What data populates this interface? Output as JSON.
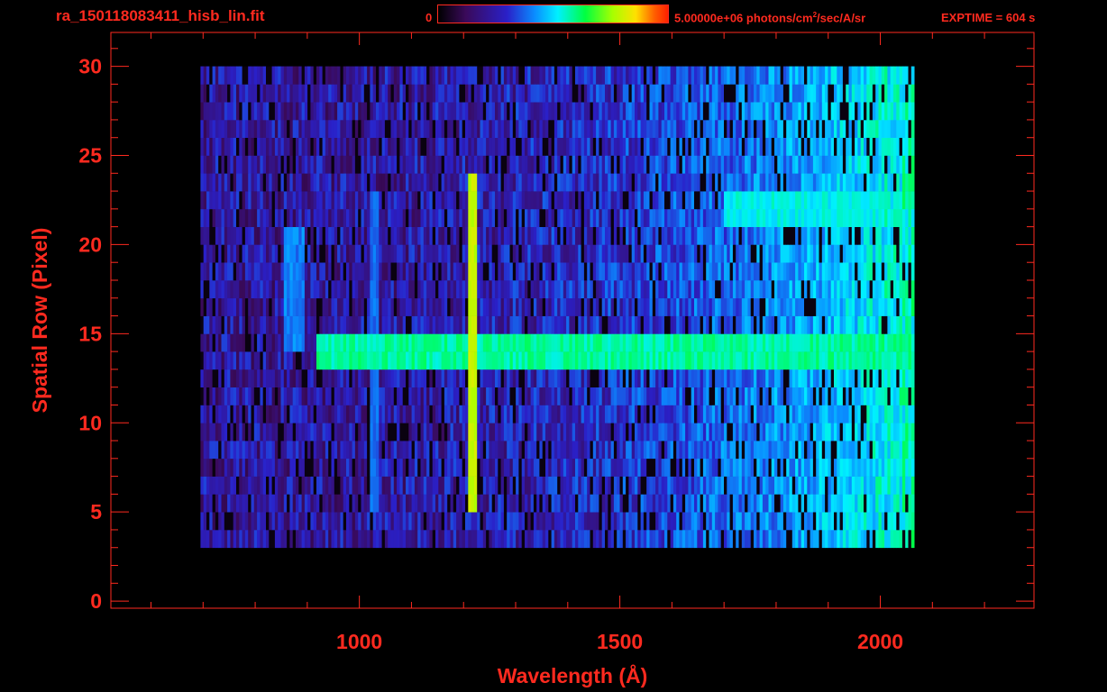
{
  "header": {
    "filename": "ra_150118083411_hisb_lin.fit",
    "colorbar_min": "0",
    "colorbar_max_prefix": "5.00000e+06 photons/cm",
    "colorbar_max_exp": "2",
    "colorbar_max_suffix": "/sec/A/sr",
    "exptime": "EXPTIME = 604 s"
  },
  "colors": {
    "axis": "#ff2a1f",
    "background": "#000000",
    "colormap": [
      "#000000",
      "#3a0a5a",
      "#2a20c8",
      "#0a8cff",
      "#00f0ff",
      "#00ff40",
      "#a8ff00",
      "#ffe000",
      "#ff6000",
      "#ff2000"
    ]
  },
  "chart_data": {
    "type": "heatmap",
    "title": "ra_150118083411_hisb_lin.fit",
    "xlabel": "Wavelength (Å)",
    "ylabel": "Spatial Row (Pixel)",
    "xlim": [
      523,
      2295
    ],
    "ylim": [
      -0.4,
      31.9
    ],
    "x_ticks": [
      1000,
      1500,
      2000
    ],
    "y_ticks": [
      0,
      5,
      10,
      15,
      20,
      25,
      30
    ],
    "colorbar": {
      "min": 0,
      "max": 5000000,
      "units": "photons/cm^2/sec/A/sr"
    },
    "data_extent": {
      "wavelength": [
        695,
        2065
      ],
      "rows": [
        3,
        30
      ]
    },
    "features": [
      {
        "name": "vertical emission line",
        "wavelength": 1216,
        "rows": [
          5,
          24
        ],
        "level": 0.7
      },
      {
        "name": "horizontal bright band",
        "wavelength": [
          920,
          2060
        ],
        "rows": [
          13,
          15
        ],
        "level": 0.5
      },
      {
        "name": "faint vertical line",
        "wavelength": 1030,
        "rows": [
          5,
          23
        ],
        "level": 0.3
      },
      {
        "name": "faint arc",
        "wavelength": [
          855,
          895
        ],
        "rows": [
          14,
          21
        ],
        "level": 0.32
      },
      {
        "name": "upper band",
        "wavelength": [
          1700,
          2060
        ],
        "rows": [
          21,
          23
        ],
        "level": 0.45
      }
    ],
    "grid": false
  }
}
